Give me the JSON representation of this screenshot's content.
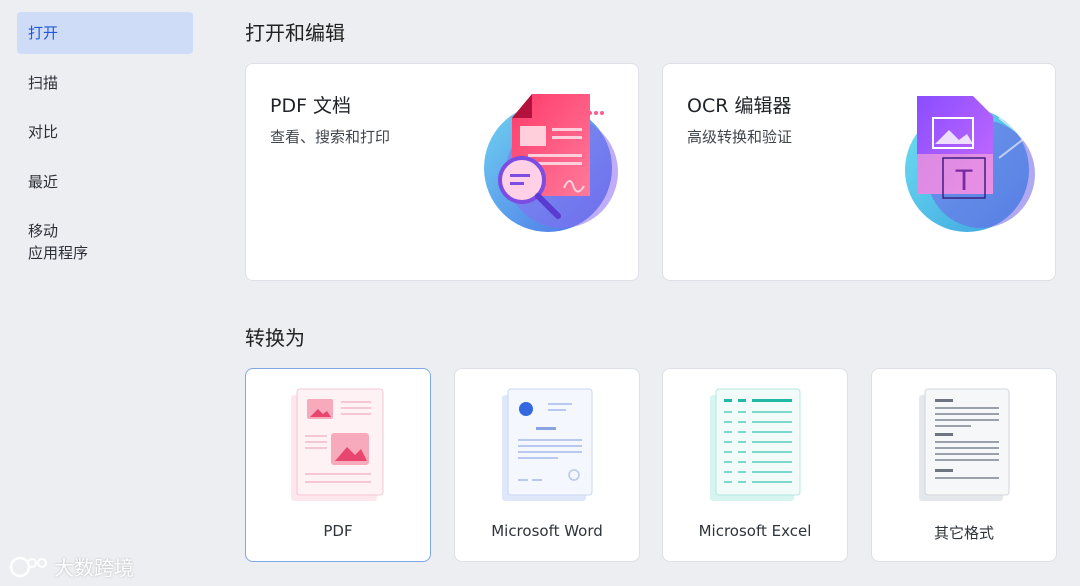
{
  "sidebar": {
    "items": [
      {
        "label": "打开",
        "active": true
      },
      {
        "label": "扫描"
      },
      {
        "label": "对比"
      },
      {
        "label": "最近"
      },
      {
        "label": "移动",
        "label2": "应用程序"
      }
    ]
  },
  "open_edit": {
    "title": "打开和编辑",
    "cards": [
      {
        "title": "PDF 文档",
        "subtitle": "查看、搜索和打印"
      },
      {
        "title": "OCR 编辑器",
        "subtitle": "高级转换和验证"
      }
    ]
  },
  "convert": {
    "title": "转换为",
    "cards": [
      {
        "label": "PDF"
      },
      {
        "label": "Microsoft Word"
      },
      {
        "label": "Microsoft Excel"
      },
      {
        "label": "其它格式"
      }
    ]
  },
  "watermark": {
    "text": "大数跨境"
  },
  "colors": {
    "accent": "#1f5bd6",
    "active_bg": "#cfdcf7",
    "background": "#eceef2",
    "card": "#ffffff",
    "selected_border": "#7fa7e8"
  }
}
